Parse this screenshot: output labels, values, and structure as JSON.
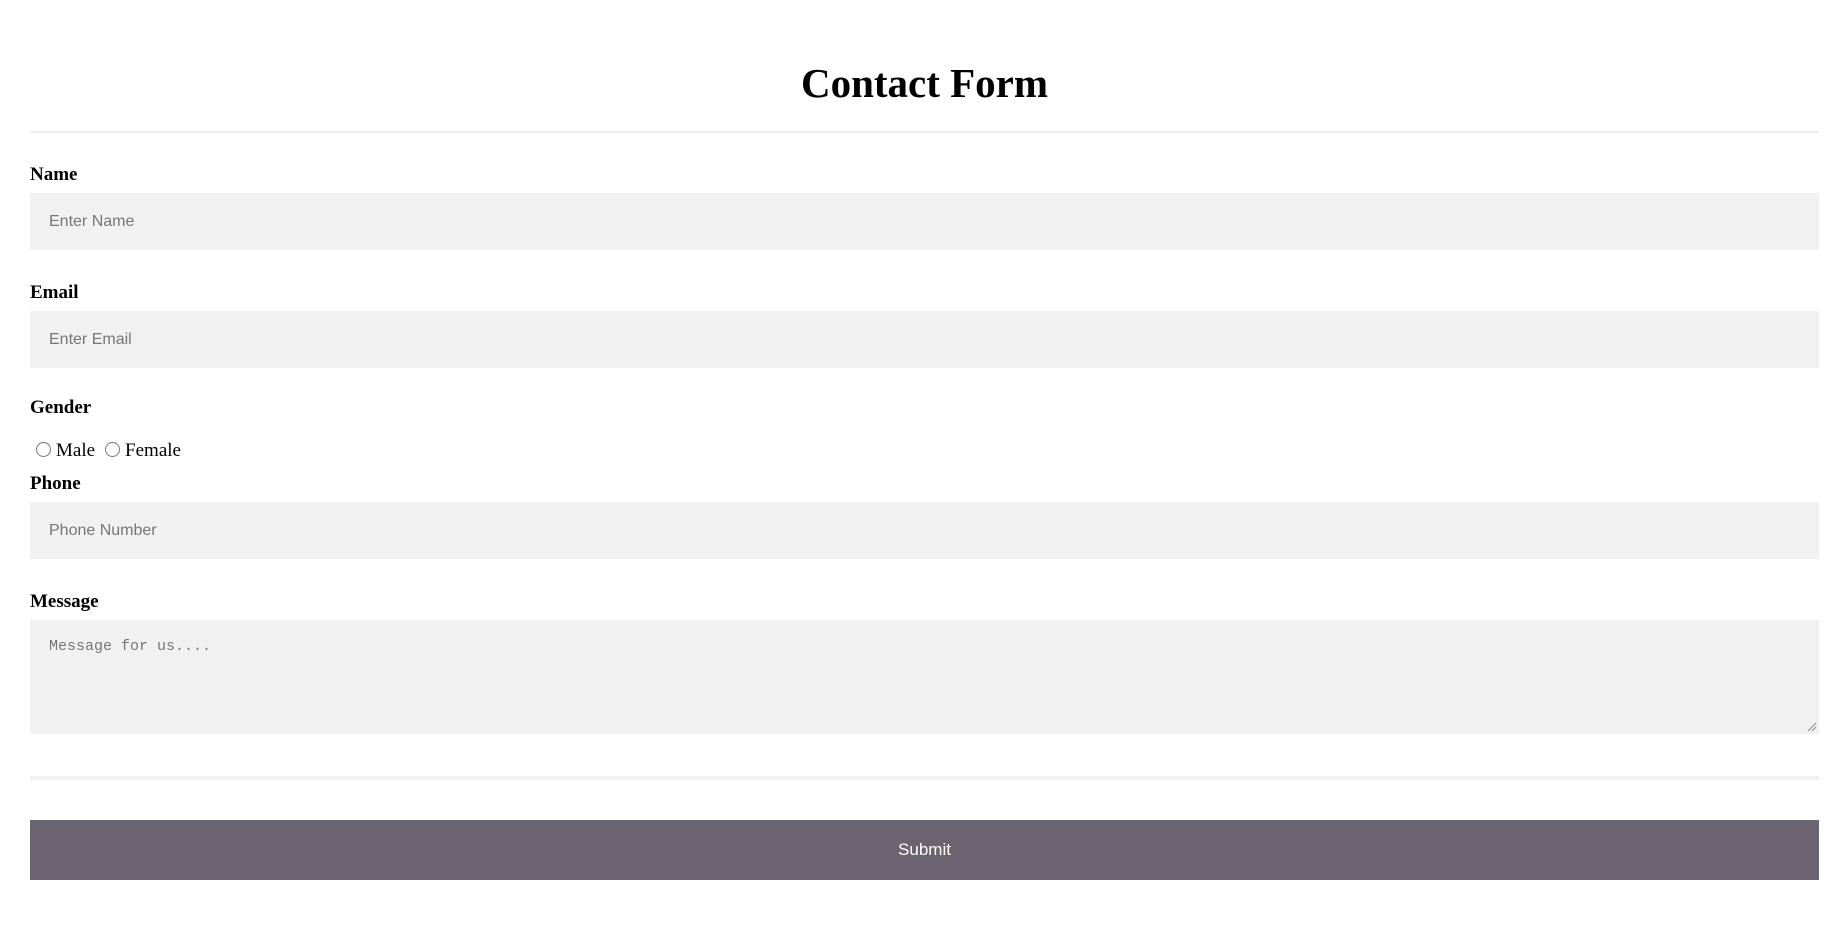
{
  "form": {
    "title": "Contact Form",
    "name": {
      "label": "Name",
      "placeholder": "Enter Name"
    },
    "email": {
      "label": "Email",
      "placeholder": "Enter Email"
    },
    "gender": {
      "label": "Gender",
      "options": [
        "Male",
        "Female"
      ]
    },
    "phone": {
      "label": "Phone",
      "placeholder": "Phone Number"
    },
    "message": {
      "label": "Message",
      "placeholder": "Message for us...."
    },
    "submit_label": "Submit"
  },
  "colors": {
    "input_background": "#f1f1f1",
    "submit_background": "#6b6470",
    "submit_text": "#ffffff",
    "divider": "#eeeeee"
  }
}
